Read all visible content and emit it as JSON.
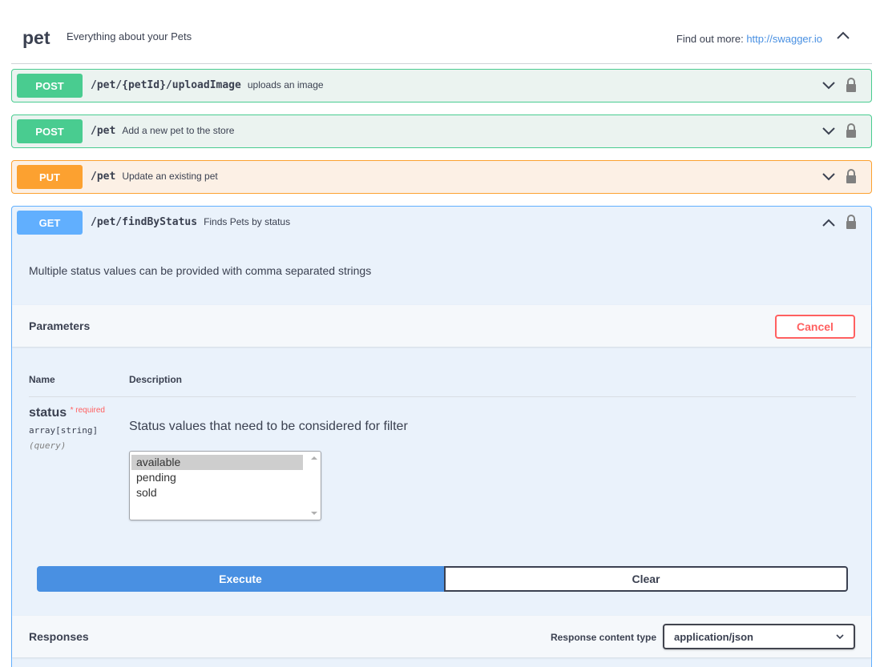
{
  "tag": {
    "name": "pet",
    "description": "Everything about your Pets",
    "find_out_more_label": "Find out more:",
    "find_out_more_link": "http://swagger.io"
  },
  "operations": [
    {
      "method": "POST",
      "path": "/pet/{petId}/uploadImage",
      "summary": "uploads an image"
    },
    {
      "method": "POST",
      "path": "/pet",
      "summary": "Add a new pet to the store"
    },
    {
      "method": "PUT",
      "path": "/pet",
      "summary": "Update an existing pet"
    },
    {
      "method": "GET",
      "path": "/pet/findByStatus",
      "summary": "Finds Pets by status"
    }
  ],
  "expanded": {
    "description": "Multiple status values can be provided with comma separated strings",
    "parameters_title": "Parameters",
    "cancel_label": "Cancel",
    "col_name": "Name",
    "col_description": "Description",
    "param": {
      "name": "status",
      "required_marker": "* required",
      "type": "array[string]",
      "in": "(query)",
      "description": "Status values that need to be considered for filter",
      "options": [
        "available",
        "pending",
        "sold"
      ],
      "selected": "available"
    },
    "execute_label": "Execute",
    "clear_label": "Clear",
    "responses_title": "Responses",
    "response_content_type_label": "Response content type",
    "response_content_type_value": "application/json"
  },
  "colors": {
    "post": "#49cc90",
    "put": "#fca130",
    "get": "#61affe",
    "execute": "#4990e2",
    "cancel": "#ff6060"
  }
}
